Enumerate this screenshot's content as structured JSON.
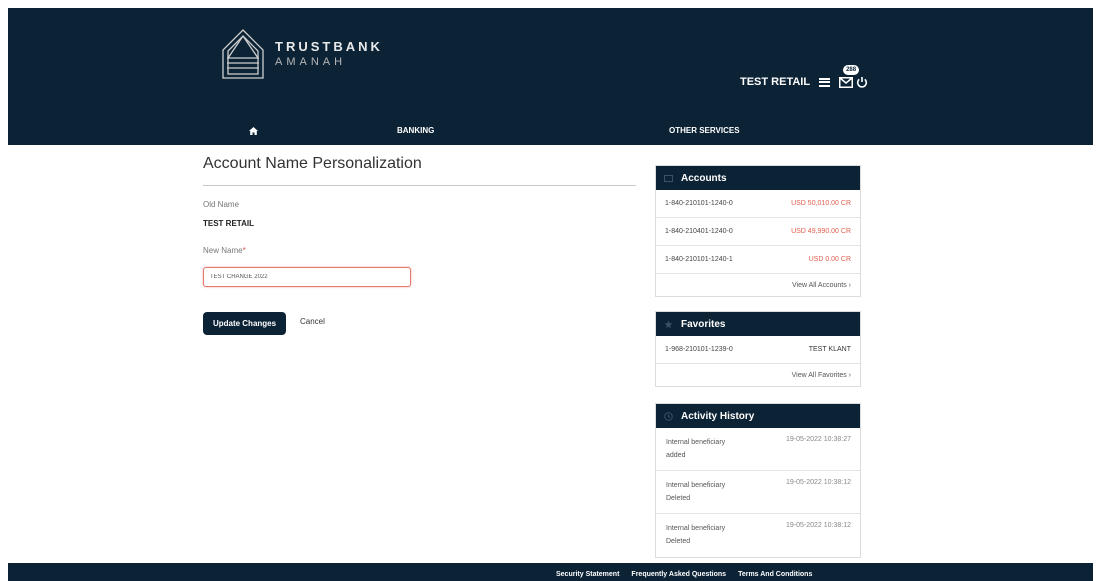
{
  "brand": {
    "name_line1": "TRUSTBANK",
    "name_line2": "AMANAH"
  },
  "header": {
    "user_name": "TEST RETAIL",
    "mail_badge": "288"
  },
  "nav": {
    "banking": "BANKING",
    "other_services": "OTHER SERVICES"
  },
  "form": {
    "title": "Account Name Personalization",
    "old_name_label": "Old Name",
    "old_name_value": "TEST RETAIL",
    "new_name_label": "New Name",
    "required_mark": "*",
    "new_name_value": "TEST CHANGE 2022",
    "update_button": "Update Changes",
    "cancel_link": "Cancel"
  },
  "accounts_panel": {
    "title": "Accounts",
    "rows": [
      {
        "account": "1-840-210101-1240-0",
        "balance": "USD 50,010.00 CR"
      },
      {
        "account": "1-840-210401-1240-0",
        "balance": "USD 49,990.00 CR"
      },
      {
        "account": "1-840-210101-1240-1",
        "balance": "USD 0.00 CR"
      }
    ],
    "view_all": "View All Accounts ›"
  },
  "favorites_panel": {
    "title": "Favorites",
    "rows": [
      {
        "account": "1-968-210101-1239-0",
        "name": "TEST KLANT"
      }
    ],
    "view_all": "View All Favorites ›"
  },
  "history_panel": {
    "title": "Activity History",
    "rows": [
      {
        "description": "Internal beneficiary added",
        "time": "19-05-2022 10:38:27"
      },
      {
        "description": "Internal beneficiary Deleted",
        "time": "19-05-2022 10:38:12"
      },
      {
        "description": "Internal beneficiary Deleted",
        "time": "19-05-2022 10:38:12"
      }
    ]
  },
  "footer": {
    "links": [
      "Security Statement",
      "Frequently Asked Questions",
      "Terms And Conditions"
    ]
  },
  "colors": {
    "primary": "#0c2336",
    "amount": "#e1604f",
    "required": "#d9534f"
  },
  "icons": {
    "logo": "trustbank-logo-icon",
    "menu": "hamburger-menu-icon",
    "mail": "mail-icon",
    "power": "power-logout-icon",
    "home": "home-icon"
  }
}
